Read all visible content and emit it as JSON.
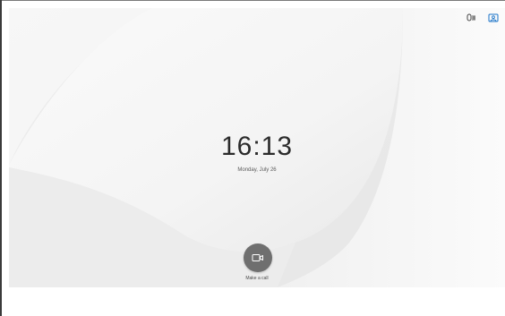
{
  "device": {
    "screen_background": "#f3f3f3"
  },
  "status_bar": {
    "icons": [
      "microphone-status-icon",
      "self-view-icon"
    ],
    "accent_color": "#1a73c8"
  },
  "home": {
    "time": "16:13",
    "date": "Monday, July 26"
  },
  "call_action": {
    "icon": "video-camera-icon",
    "label": "Make a call",
    "color": "#6f6f6f"
  }
}
